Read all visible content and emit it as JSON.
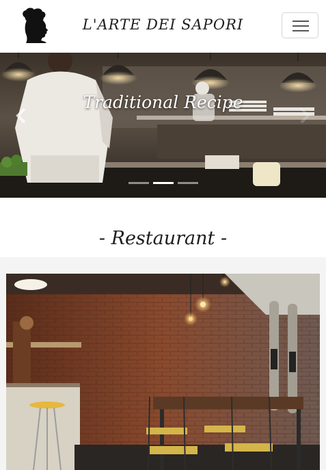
{
  "navbar": {
    "brand": "L'ARTE DEI SAPORI",
    "logo_icon": "chef-head-logo-icon",
    "menu_icon": "hamburger-menu-icon"
  },
  "carousel": {
    "caption": "Traditional Recipe",
    "prev_icon": "chevron-left-icon",
    "next_icon": "chevron-right-icon",
    "slide_count": 3,
    "active_slide": 2
  },
  "section": {
    "heading": "- Restaurant -"
  },
  "colors": {
    "page_background": "#ffffff",
    "section_band": "#f4f4f4",
    "text": "#1d1d1d"
  }
}
